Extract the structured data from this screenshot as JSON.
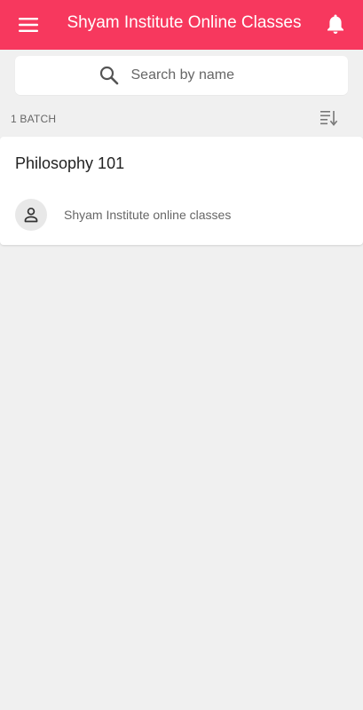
{
  "app_bar": {
    "title": "Shyam Institute Online Classes",
    "menu_icon": "hamburger-menu-icon",
    "notification_icon": "bell-icon",
    "color": "#f7385e"
  },
  "search": {
    "placeholder": "Search by name",
    "value": "",
    "icon": "search-icon"
  },
  "list_header": {
    "count_label": "1 BATCH",
    "sort_icon": "sort-icon"
  },
  "batches": [
    {
      "name": "Philosophy 101",
      "owner": "Shyam Institute online classes",
      "avatar_icon": "person-icon"
    }
  ]
}
